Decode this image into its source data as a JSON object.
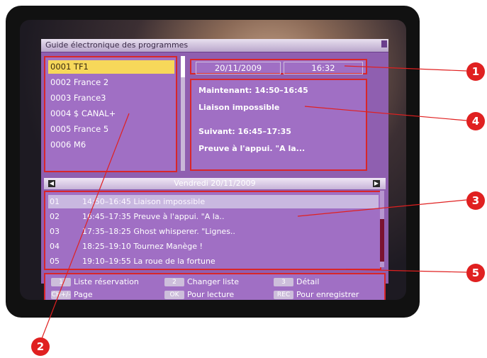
{
  "guide": {
    "title": "Guide électronique des programmes",
    "channels": [
      {
        "label": "0001 TF1",
        "selected": true
      },
      {
        "label": "0002 France 2",
        "selected": false
      },
      {
        "label": "0003 France3",
        "selected": false
      },
      {
        "label": "0004 $ CANAL+",
        "selected": false
      },
      {
        "label": "0005 France 5",
        "selected": false
      },
      {
        "label": "0006 M6",
        "selected": false
      }
    ],
    "date": "20/11/2009",
    "time": "16:32",
    "info": {
      "now": "Maintenant: 14:50–16:45",
      "now_title": "Liaison impossible",
      "next": "Suivant: 16:45–17:35",
      "next_title": "Preuve à l'appui. \"A la..."
    },
    "day_label": "Vendredi 20/11/2009",
    "events": [
      {
        "num": "01",
        "text": "14:50–16:45 Liaison impossible",
        "selected": true
      },
      {
        "num": "02",
        "text": "16:45–17:35 Preuve à l'appui. \"A la..",
        "selected": false
      },
      {
        "num": "03",
        "text": "17:35–18:25 Ghost whisperer. \"Lignes..",
        "selected": false
      },
      {
        "num": "04",
        "text": "18:25–19:10 Tournez Manège !",
        "selected": false
      },
      {
        "num": "05",
        "text": "19:10–19:55 La roue de la fortune",
        "selected": false
      }
    ],
    "legend": {
      "key1": "1",
      "text1": "Liste réservation",
      "key2": "2",
      "text2": "Changer liste",
      "key3": "3",
      "text3": "Détail",
      "key4": "CH+/-",
      "text4": "Page",
      "key5": "OK",
      "text5": "Pour lecture",
      "key6": "REC",
      "text6": "Pour enregistrer"
    }
  },
  "callouts": [
    "1",
    "2",
    "3",
    "4",
    "5"
  ],
  "colors": {
    "osd_bg": "#8f5fb0",
    "highlight": "#f7d85a",
    "callout": "#e02020"
  }
}
